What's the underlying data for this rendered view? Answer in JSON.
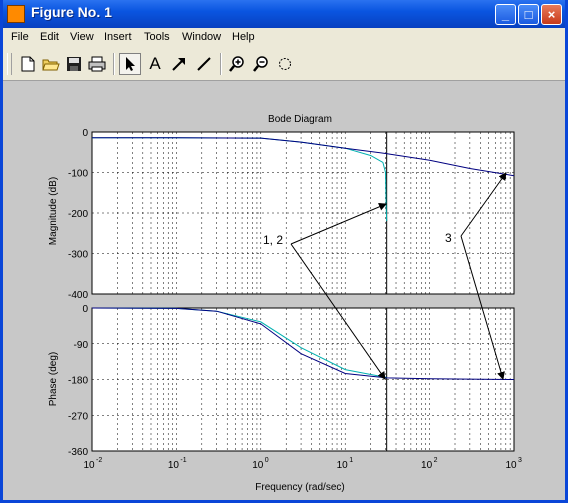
{
  "window": {
    "title": "Figure No. 1",
    "buttons": {
      "minimize": "_",
      "maximize": "□",
      "close": "×"
    }
  },
  "menu": [
    "File",
    "Edit",
    "View",
    "Insert",
    "Tools",
    "Window",
    "Help"
  ],
  "toolbar": {
    "tools": [
      "new-file-icon",
      "open-folder-icon",
      "save-icon",
      "print-icon",
      "select-arrow-icon",
      "text-icon",
      "arrow-icon",
      "line-icon",
      "zoom-in-icon",
      "zoom-out-icon",
      "rotate-icon"
    ],
    "text_tool_label": "A",
    "active_tool": "select-arrow-icon"
  },
  "plot": {
    "title": "Bode Diagram",
    "xlabel": "Frequency  (rad/sec)",
    "mag_ylabel": "Magnitude (dB)",
    "phase_ylabel": "Phase (deg)",
    "x_ticks": [
      {
        "base": "10",
        "exp": "-2"
      },
      {
        "base": "10",
        "exp": "-1"
      },
      {
        "base": "10",
        "exp": "0"
      },
      {
        "base": "10",
        "exp": "1"
      },
      {
        "base": "10",
        "exp": "2"
      },
      {
        "base": "10",
        "exp": "3"
      }
    ],
    "mag_ticks": [
      "0",
      "-100",
      "-200",
      "-300",
      "-400"
    ],
    "phase_ticks": [
      "0",
      "-90",
      "-180",
      "-270",
      "-360"
    ],
    "annotation_12": "1, 2",
    "annotation_3": "3"
  },
  "chart_data": [
    {
      "type": "line",
      "title": "Bode Diagram",
      "xlabel": "Frequency  (rad/sec)",
      "ylabel": "Magnitude (dB)",
      "xscale": "log",
      "xlim": [
        0.01,
        1000
      ],
      "ylim": [
        -400,
        0
      ],
      "grid": true,
      "series": [
        {
          "color": "#00b0b0",
          "x": [
            0.01,
            0.1,
            1,
            3,
            10,
            20,
            28,
            30,
            30.5,
            31
          ],
          "y": [
            -14,
            -14,
            -15,
            -25,
            -40,
            -58,
            -75,
            -100,
            -180,
            -220
          ]
        },
        {
          "color": "#000080",
          "x": [
            0.01,
            0.1,
            1,
            3,
            10,
            30,
            100,
            300,
            1000
          ],
          "y": [
            -14,
            -14,
            -15,
            -25,
            -40,
            -53,
            -70,
            -90,
            -108
          ]
        }
      ],
      "vertical_line_x": 31
    },
    {
      "type": "line",
      "xlabel": "Frequency  (rad/sec)",
      "ylabel": "Phase (deg)",
      "xscale": "log",
      "xlim": [
        0.01,
        1000
      ],
      "ylim": [
        -360,
        0
      ],
      "grid": true,
      "series": [
        {
          "color": "#00b0b0",
          "x": [
            0.01,
            0.1,
            0.3,
            1,
            3,
            10,
            31
          ],
          "y": [
            0,
            -1,
            -8,
            -35,
            -100,
            -155,
            -175
          ]
        },
        {
          "color": "#000080",
          "x": [
            0.01,
            0.1,
            0.3,
            1,
            3,
            10,
            31,
            100,
            1000
          ],
          "y": [
            0,
            -1,
            -8,
            -40,
            -115,
            -165,
            -176,
            -178,
            -180
          ]
        }
      ],
      "vertical_line_x": 31
    }
  ]
}
